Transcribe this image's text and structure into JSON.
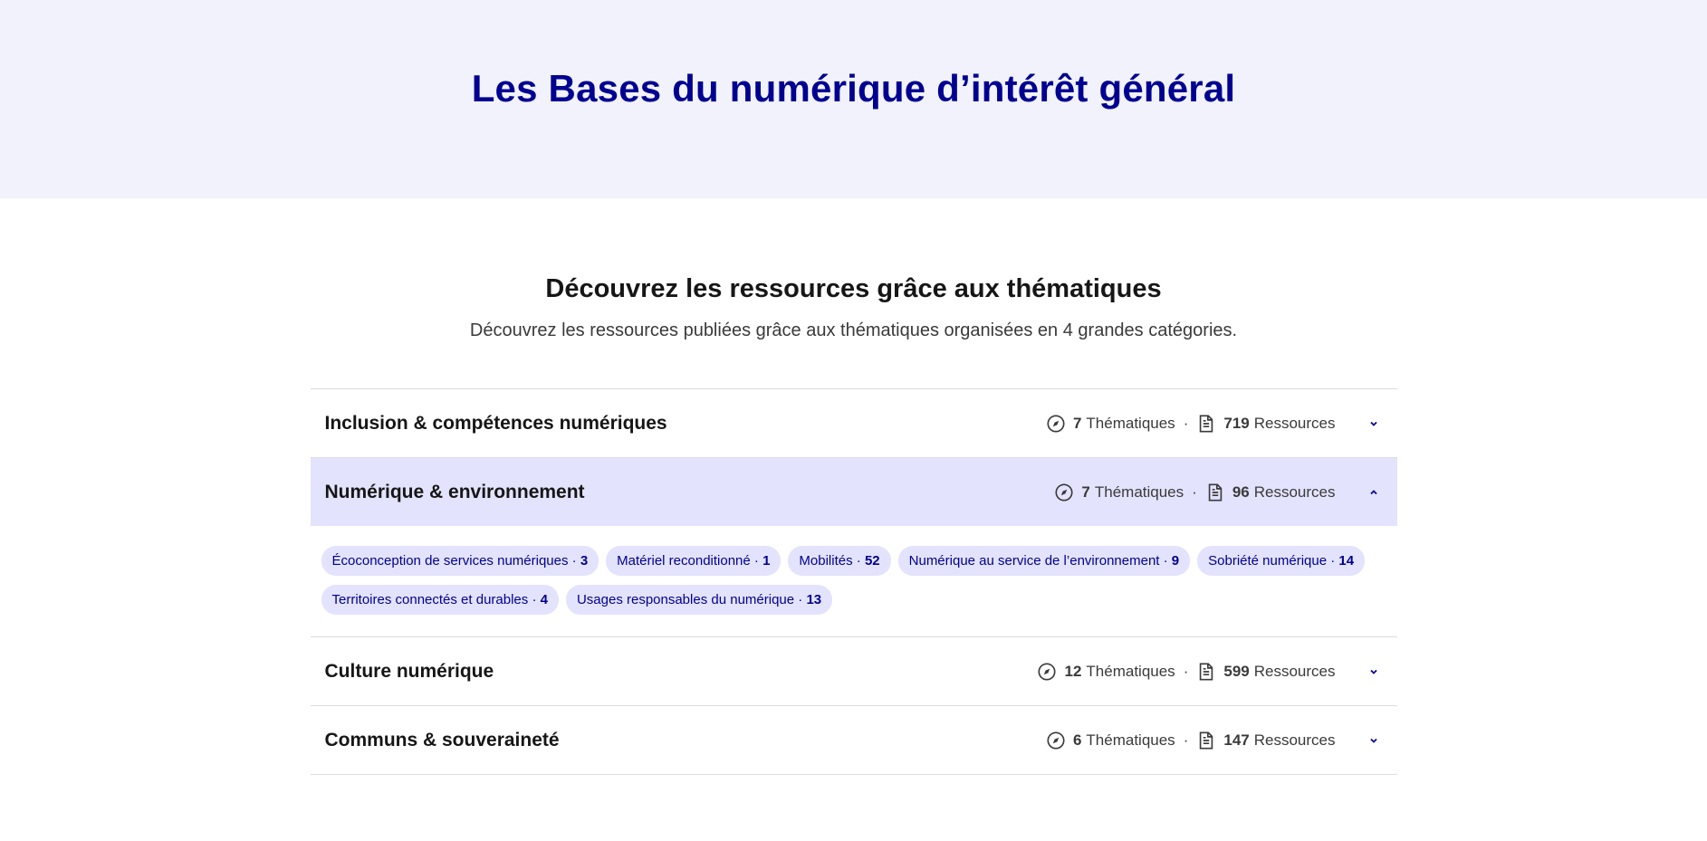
{
  "hero": {
    "title": "Les Bases du numérique d’intérêt général"
  },
  "section": {
    "title": "Découvrez les ressources grâce aux thématiques",
    "subtitle": "Découvrez les ressources publiées grâce aux thématiques organisées en 4 grandes catégories."
  },
  "labels": {
    "thematiques": "Thématiques",
    "ressources": "Ressources",
    "separator": "·"
  },
  "categories": [
    {
      "title": "Inclusion & compétences numériques",
      "thematiques": "7",
      "ressources": "719",
      "open": false
    },
    {
      "title": "Numérique & environnement",
      "thematiques": "7",
      "ressources": "96",
      "open": true,
      "tags": [
        {
          "label": "Écoconception de services numériques · ",
          "count": "3"
        },
        {
          "label": "Matériel reconditionné · ",
          "count": "1"
        },
        {
          "label": "Mobilités · ",
          "count": "52"
        },
        {
          "label": "Numérique au service de l’environnement · ",
          "count": "9"
        },
        {
          "label": "Sobriété numérique · ",
          "count": "14"
        },
        {
          "label": "Territoires connectés et durables · ",
          "count": "4"
        },
        {
          "label": "Usages responsables du numérique · ",
          "count": "13"
        }
      ]
    },
    {
      "title": "Culture numérique",
      "thematiques": "12",
      "ressources": "599",
      "open": false
    },
    {
      "title": "Communs & souveraineté",
      "thematiques": "6",
      "ressources": "147",
      "open": false
    }
  ],
  "icons": {
    "compass": "compass-icon",
    "document": "document-icon",
    "chevron_down": "chevron-down-icon",
    "chevron_up": "chevron-up-icon"
  },
  "colors": {
    "brand_blue": "#000091",
    "hero_bg": "#f1f2fc",
    "open_bg": "#e3e3fd",
    "tag_bg": "#e3e3fd"
  }
}
